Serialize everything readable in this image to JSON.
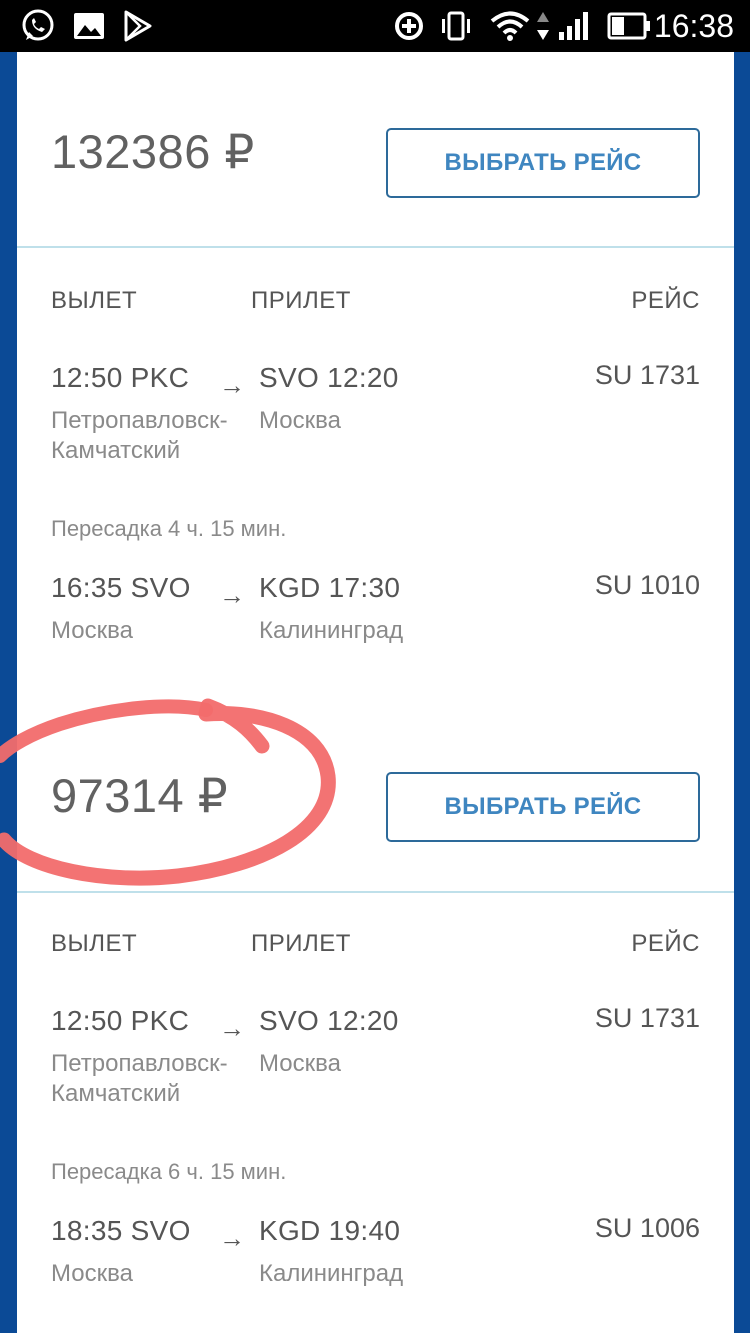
{
  "status_bar": {
    "time": "16:38",
    "left_icons": [
      "whatsapp-icon",
      "gallery-icon",
      "play-store-icon"
    ],
    "right_icons": [
      "data-saver-icon",
      "vibrate-icon",
      "wifi-icon",
      "signal-icon",
      "battery-icon"
    ]
  },
  "offers": [
    {
      "price": "132386 ₽",
      "select_label": "ВЫБРАТЬ РЕЙС"
    },
    {
      "price": "97314 ₽",
      "select_label": "ВЫБРАТЬ РЕЙС"
    }
  ],
  "columns": {
    "departure": "ВЫЛЕТ",
    "arrival": "ПРИЛЕТ",
    "flight": "РЕЙС"
  },
  "itineraries": [
    {
      "leg1": {
        "dep": "12:50 PKC",
        "dep_city": "Петропавловск-Камчатский",
        "arr": "SVO 12:20",
        "arr_city": "Москва",
        "flight": "SU 1731"
      },
      "transfer": "Пересадка 4 ч. 15 мин.",
      "leg2": {
        "dep": "16:35 SVO",
        "dep_city": "Москва",
        "arr": "KGD 17:30",
        "arr_city": "Калининград",
        "flight": "SU 1010"
      }
    },
    {
      "leg1": {
        "dep": "12:50 PKC",
        "dep_city": "Петропавловск-Камчатский",
        "arr": "SVO 12:20",
        "arr_city": "Москва",
        "flight": "SU 1731"
      },
      "transfer": "Пересадка 6 ч. 15 мин.",
      "leg2": {
        "dep": "18:35 SVO",
        "dep_city": "Москва",
        "arr": "KGD 19:40",
        "arr_city": "Калининград",
        "flight": "SU 1006"
      }
    }
  ],
  "arrow_glyph": "→",
  "colors": {
    "accent": "#3f86c0",
    "frame": "#0b4a96",
    "annotation": "#f26b6b"
  }
}
